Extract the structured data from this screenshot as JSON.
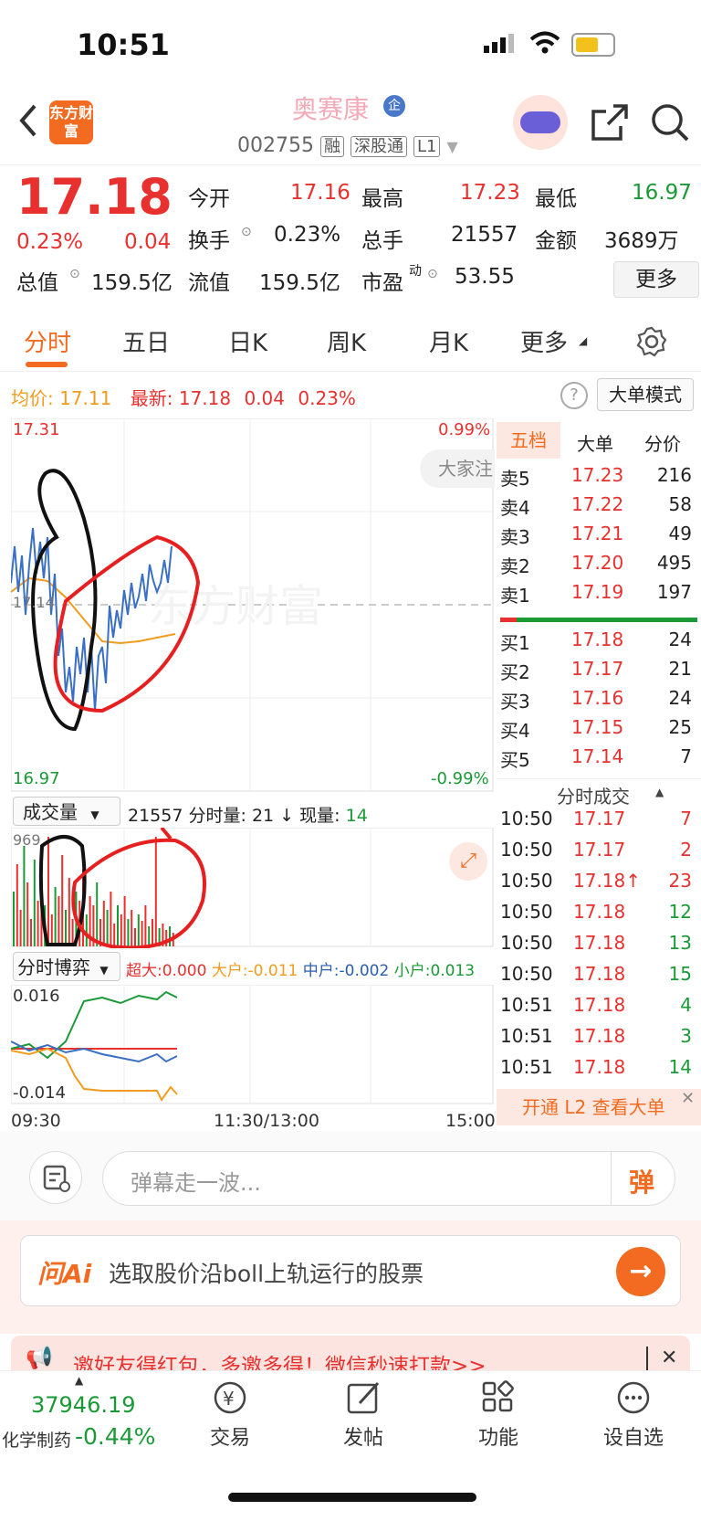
{
  "status_bar": {
    "time": "10:51"
  },
  "header": {
    "logo_text": "东方财富",
    "stock_name": "奥赛康",
    "stock_code": "002755",
    "tags": [
      "融",
      "深股通",
      "L1"
    ],
    "enterprise_badge": "企"
  },
  "quote": {
    "price": "17.18",
    "change_pct": "0.23%",
    "change": "0.04",
    "open_label": "今开",
    "open": "17.16",
    "high_label": "最高",
    "high": "17.23",
    "low_label": "最低",
    "low": "16.97",
    "turnover_label": "换手",
    "turnover": "0.23%",
    "volume_label": "总手",
    "volume": "21557",
    "amount_label": "金额",
    "amount": "3689万",
    "mktcap_label": "总值",
    "mktcap": "159.5亿",
    "float_label": "流值",
    "float_cap": "159.5亿",
    "pe_label": "市盈",
    "pe_sup": "动",
    "pe": "53.55",
    "more_label": "更多"
  },
  "tabs": [
    "分时",
    "五日",
    "日K",
    "周K",
    "月K",
    "更多"
  ],
  "intraday": {
    "avg_label": "均价:",
    "avg": "17.11",
    "latest_label": "最新:",
    "latest": "17.18",
    "latest_change": "0.04",
    "latest_pct": "0.23%",
    "big_order_mode": "大单模式",
    "top_price": "17.31",
    "top_pct": "0.99%",
    "mid_price": "17.14",
    "bottom_price": "16.97",
    "bottom_pct": "-0.99%",
    "chat_bubble": "大家注",
    "watermark": "东方财富",
    "volume_dropdown": "成交量",
    "volume_info": "21557",
    "minute_vol_label": "分时量:",
    "minute_vol": "21",
    "current_vol_label": "现量:",
    "current_vol": "14",
    "vol_max": "969",
    "game_dropdown": "分时博弈",
    "super_label": "超大:",
    "super_val": "0.000",
    "large_label": "大户:",
    "large_val": "-0.011",
    "mid_label": "中户:",
    "mid_val": "-0.002",
    "small_label": "小户:",
    "small_val": "0.013",
    "game_top": "0.016",
    "game_bottom": "-0.014",
    "time_axis": [
      "09:30",
      "11:30/13:00",
      "15:00"
    ]
  },
  "order_book": {
    "tabs": [
      "五档",
      "大单",
      "分价"
    ],
    "asks": [
      {
        "label": "卖5",
        "price": "17.23",
        "vol": "216"
      },
      {
        "label": "卖4",
        "price": "17.22",
        "vol": "58"
      },
      {
        "label": "卖3",
        "price": "17.21",
        "vol": "49"
      },
      {
        "label": "卖2",
        "price": "17.20",
        "vol": "495"
      },
      {
        "label": "卖1",
        "price": "17.19",
        "vol": "197"
      }
    ],
    "bids": [
      {
        "label": "买1",
        "price": "17.18",
        "vol": "24"
      },
      {
        "label": "买2",
        "price": "17.17",
        "vol": "21"
      },
      {
        "label": "买3",
        "price": "17.16",
        "vol": "24"
      },
      {
        "label": "买4",
        "price": "17.15",
        "vol": "25"
      },
      {
        "label": "买5",
        "price": "17.14",
        "vol": "7"
      }
    ],
    "trades_title": "分时成交",
    "trades": [
      {
        "time": "10:50",
        "price": "17.17",
        "vol": "7",
        "dir": "up"
      },
      {
        "time": "10:50",
        "price": "17.17",
        "vol": "2",
        "dir": "up"
      },
      {
        "time": "10:50",
        "price": "17.18↑",
        "vol": "23",
        "dir": "up"
      },
      {
        "time": "10:50",
        "price": "17.18",
        "vol": "12",
        "dir": "down"
      },
      {
        "time": "10:50",
        "price": "17.18",
        "vol": "13",
        "dir": "down"
      },
      {
        "time": "10:50",
        "price": "17.18",
        "vol": "15",
        "dir": "down"
      },
      {
        "time": "10:51",
        "price": "17.18",
        "vol": "4",
        "dir": "down"
      },
      {
        "time": "10:51",
        "price": "17.18",
        "vol": "3",
        "dir": "down"
      },
      {
        "time": "10:51",
        "price": "17.18",
        "vol": "14",
        "dir": "down"
      }
    ],
    "l2_banner": "开通 L2 查看大单"
  },
  "comment": {
    "placeholder": "弹幕走一波...",
    "button": "弹"
  },
  "ai": {
    "logo": "问Ai",
    "prompt": "选取股价沿boll上轨运行的股票"
  },
  "promo": {
    "text": "邀好友得红包，多邀多得！微信秒速打款>>"
  },
  "bottom_nav": {
    "index_value": "37946.19",
    "index_name": "化学制药",
    "index_change": "-0.44%",
    "items": [
      "交易",
      "发帖",
      "功能",
      "设自选"
    ]
  },
  "colors": {
    "up": "#e8312f",
    "down": "#1a9a36",
    "brand": "#f36b21",
    "price_line": "#3a6fc4",
    "avg_line": "#f29c1f"
  }
}
